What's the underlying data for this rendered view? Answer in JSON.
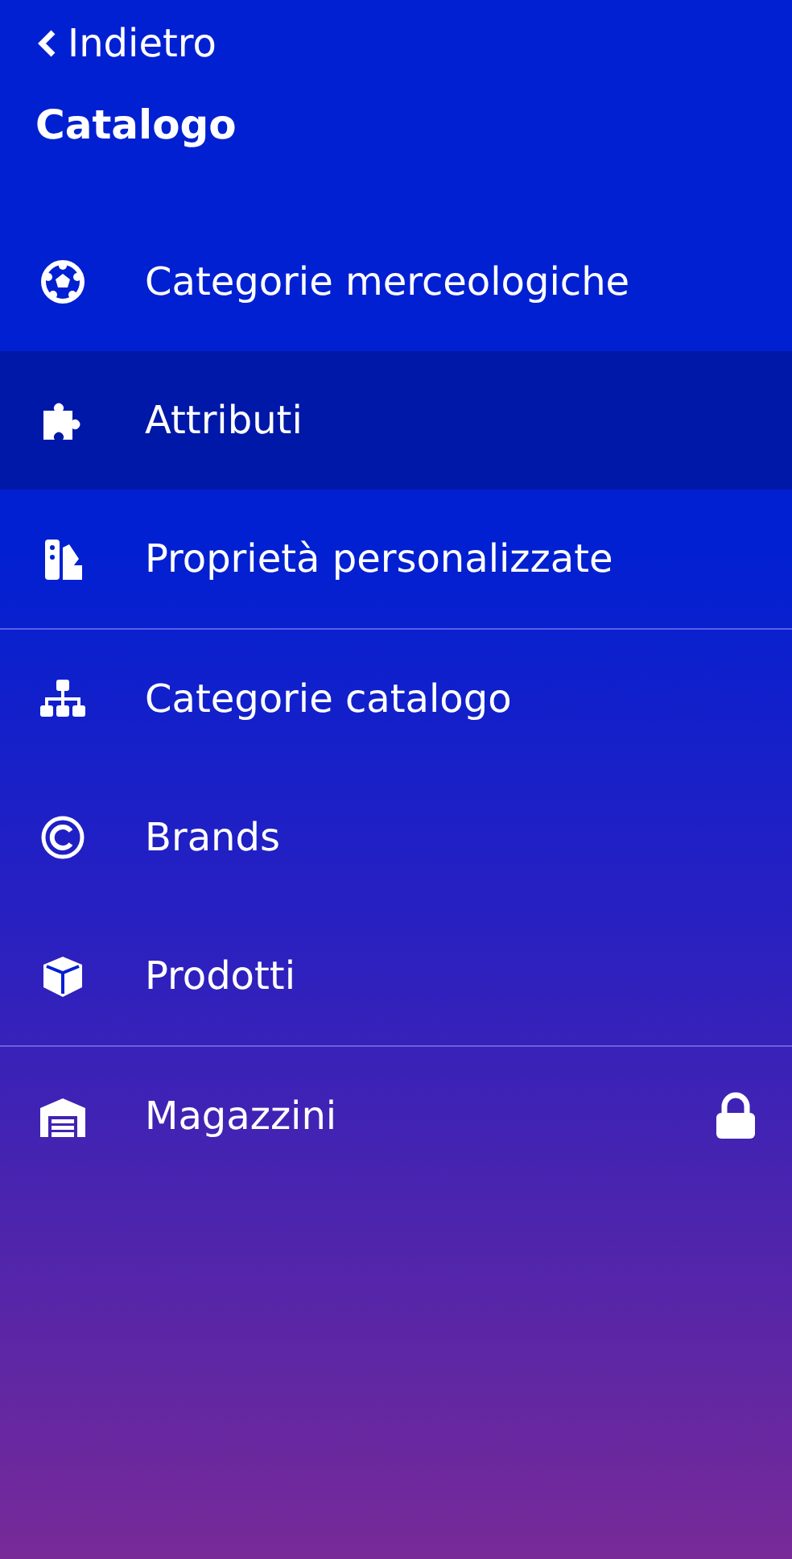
{
  "back_link": {
    "label": "Indietro"
  },
  "section_title": "Catalogo",
  "groups": [
    {
      "items": [
        {
          "label": "Categorie merceologiche",
          "selected": false,
          "locked": false
        },
        {
          "label": "Attributi",
          "selected": true,
          "locked": false
        },
        {
          "label": "Proprietà personalizzate",
          "selected": false,
          "locked": false
        }
      ]
    },
    {
      "items": [
        {
          "label": "Categorie catalogo",
          "selected": false,
          "locked": false
        },
        {
          "label": "Brands",
          "selected": false,
          "locked": false
        },
        {
          "label": "Prodotti",
          "selected": false,
          "locked": false
        }
      ]
    },
    {
      "items": [
        {
          "label": "Magazzini",
          "selected": false,
          "locked": true
        }
      ]
    }
  ]
}
